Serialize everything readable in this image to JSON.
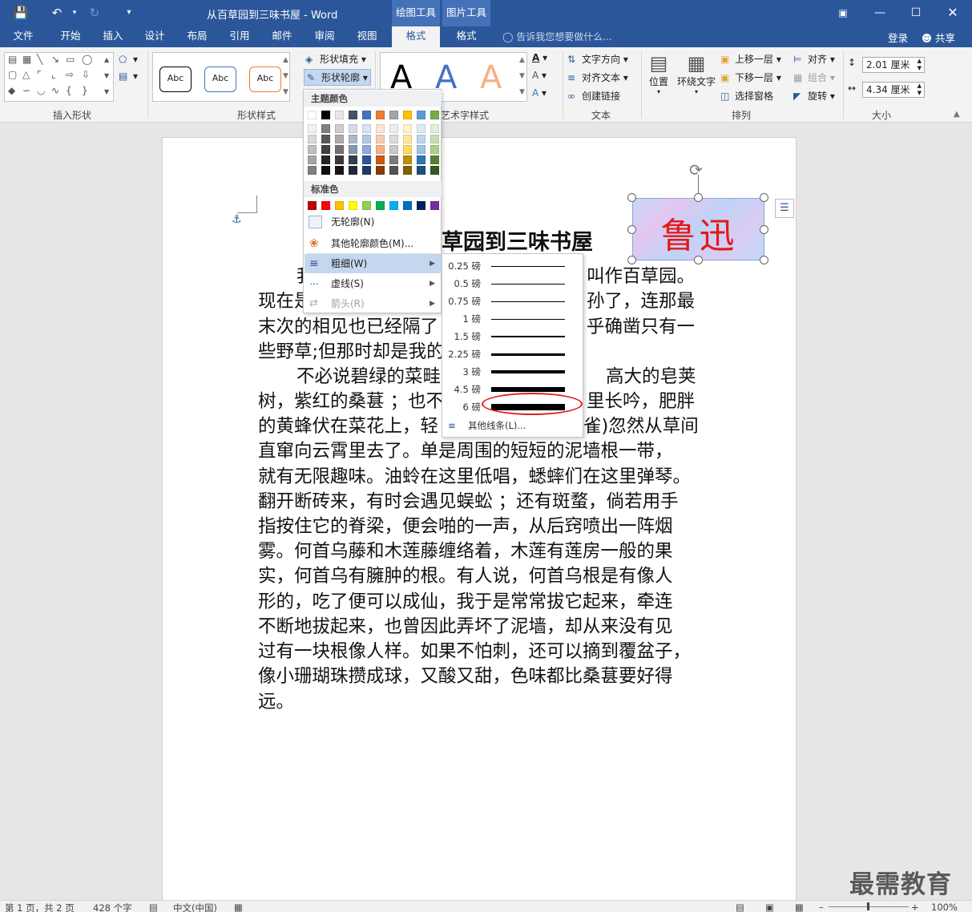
{
  "titlebar": {
    "title": "从百草园到三味书屋 - Word",
    "context_tabs": [
      "绘图工具",
      "图片工具"
    ]
  },
  "tabs": [
    "文件",
    "开始",
    "插入",
    "设计",
    "布局",
    "引用",
    "邮件",
    "审阅",
    "视图",
    "格式",
    "格式"
  ],
  "tellme": "告诉我您想要做什么...",
  "login": "登录",
  "share": "共享",
  "ribbon": {
    "groups": [
      "插入形状",
      "形状样式",
      "艺术字样式",
      "文本",
      "排列",
      "大小"
    ],
    "style_sample": "Abc",
    "shape_fill": "形状填充",
    "shape_outline": "形状轮廓",
    "text_direction": "文字方向",
    "align_text": "对齐文本",
    "create_link": "创建链接",
    "position": "位置",
    "wrap_text": "环绕文字",
    "bring_forward": "上移一层",
    "send_backward": "下移一层",
    "selection_pane": "选择窗格",
    "align": "对齐",
    "group": "组合",
    "rotate": "旋转",
    "height": "2.01 厘米",
    "width": "4.34 厘米",
    "wordart_letter": "A"
  },
  "menu": {
    "theme_colors": "主题颜色",
    "standard_colors": "标准色",
    "no_outline": "无轮廓(N)",
    "more_colors": "其他轮廓颜色(M)...",
    "weight": "粗细(W)",
    "dashes": "虚线(S)",
    "arrows": "箭头(R)",
    "theme_row": [
      "#ffffff",
      "#000000",
      "#e7e6e6",
      "#44546a",
      "#4472c4",
      "#ed7d31",
      "#a5a5a5",
      "#ffc000",
      "#5b9bd5",
      "#70ad47"
    ],
    "shade_cols": [
      [
        "#f2f2f2",
        "#d9d9d9",
        "#bfbfbf",
        "#a6a6a6",
        "#808080"
      ],
      [
        "#808080",
        "#595959",
        "#404040",
        "#262626",
        "#0d0d0d"
      ],
      [
        "#d0cece",
        "#aeaaaa",
        "#767171",
        "#3a3838",
        "#171616"
      ],
      [
        "#d6dce5",
        "#adb9ca",
        "#8497b0",
        "#333f50",
        "#222a35"
      ],
      [
        "#dae3f3",
        "#b4c7e7",
        "#8faadc",
        "#2f5597",
        "#1f3864"
      ],
      [
        "#fbe5d6",
        "#f8cbad",
        "#f4b183",
        "#c55a11",
        "#843c0c"
      ],
      [
        "#ededed",
        "#dbdbdb",
        "#c9c9c9",
        "#7b7b7b",
        "#525252"
      ],
      [
        "#fff2cc",
        "#ffe699",
        "#ffd966",
        "#bf9000",
        "#7f6000"
      ],
      [
        "#deebf7",
        "#bdd7ee",
        "#9dc3e6",
        "#2e75b6",
        "#1f4e79"
      ],
      [
        "#e2f0d9",
        "#c5e0b4",
        "#a9d18e",
        "#548235",
        "#375623"
      ]
    ],
    "standard_row": [
      "#c00000",
      "#ff0000",
      "#ffc000",
      "#ffff00",
      "#92d050",
      "#00b050",
      "#00b0f0",
      "#0070c0",
      "#002060",
      "#7030a0"
    ]
  },
  "submenu": {
    "weights": [
      "0.25 磅",
      "0.5 磅",
      "0.75 磅",
      "1 磅",
      "1.5 磅",
      "2.25 磅",
      "3 磅",
      "4.5 磅",
      "6 磅"
    ],
    "weight_values_pt": [
      0.25,
      0.5,
      0.75,
      1,
      1.5,
      2.25,
      3,
      4.5,
      6
    ],
    "more_lines": "其他线条(L)..."
  },
  "document": {
    "heading": "草园到三味书屋",
    "lines": [
      "叫作百草园。",
      "孙了，连那最",
      "乎确凿只有一",
      "高大的皂荚",
      "里长吟，肥胖",
      "雀)忽然从草间",
      "直窜向云霄里去了。单是周围的短短的泥墙根一带，",
      "就有无限趣味。油蛉在这里低唱，蟋蟀们在这里弹琴。",
      "翻开断砖来，有时会遇见蜈蚣 ；还有斑蝥，倘若用手",
      "指按住它的脊梁，便会啪的一声，从后窍喷出一阵烟",
      "雾。何首乌藤和木莲藤缠络着，木莲有莲房一般的果",
      "实，何首乌有臃肿的根。有人说，何首乌根是有像人",
      "形的，吃了便可以成仙，我于是常常拔它起来，牵连",
      "不断地拔起来，也曾因此弄坏了泥墙，却从来没有见",
      "过有一块根像人样。如果不怕刺，还可以摘到覆盆子，",
      "像小珊瑚珠攒成球，又酸又甜，色味都比桑葚要好得",
      "远。"
    ],
    "left_fragments": [
      "我",
      "现在是",
      "末次的相见也已经隔了",
      "些野草;但那时却是我的",
      "不必说碧绿的菜畦",
      "树，紫红的桑葚 ；也不",
      "的黄蜂伏在菜花上，轻"
    ],
    "image_text": "鲁迅"
  },
  "status": {
    "page": "第 1 页，共 2 页",
    "words": "428 个字",
    "lang": "中文(中国)",
    "zoom": "100%"
  },
  "watermark": "最需教育"
}
